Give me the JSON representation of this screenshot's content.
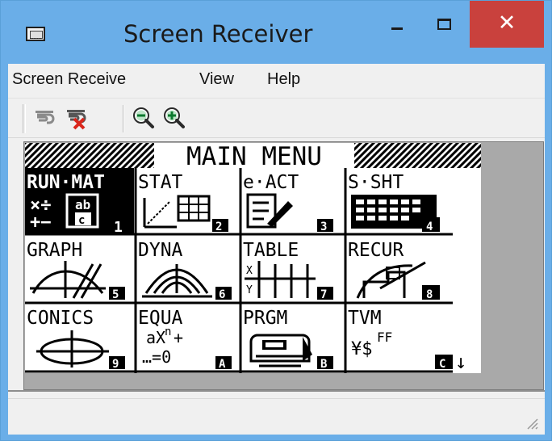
{
  "window": {
    "title": "Screen Receiver"
  },
  "controls": {
    "close": "✕"
  },
  "menubar": {
    "items": [
      "Screen Receive",
      "View",
      "Help"
    ]
  },
  "toolbar": {
    "buttons": [
      "receive-icon",
      "stop-receive-icon",
      "zoom-out-icon",
      "zoom-in-icon"
    ]
  },
  "calculator": {
    "header": "MAIN MENU",
    "tiles": [
      {
        "label": "RUN·MAT",
        "num": "1",
        "selected": true
      },
      {
        "label": "STAT",
        "num": "2"
      },
      {
        "label": "e·ACT",
        "num": "3"
      },
      {
        "label": "S·SHT",
        "num": "4"
      },
      {
        "label": "GRAPH",
        "num": "5"
      },
      {
        "label": "DYNA",
        "num": "6"
      },
      {
        "label": "TABLE",
        "num": "7"
      },
      {
        "label": "RECUR",
        "num": "8"
      },
      {
        "label": "CONICS",
        "num": "9"
      },
      {
        "label": "EQUA",
        "num": "A"
      },
      {
        "label": "PRGM",
        "num": "B"
      },
      {
        "label": "TVM",
        "num": "C"
      }
    ],
    "equa_text_1": "aX",
    "equa_text_1_sup": "n",
    "equa_text_1_tail": "+",
    "equa_text_2": "…=0",
    "tvm_text": "¥$",
    "tvm_sup": "FF",
    "scroll_arrow": "↓"
  }
}
